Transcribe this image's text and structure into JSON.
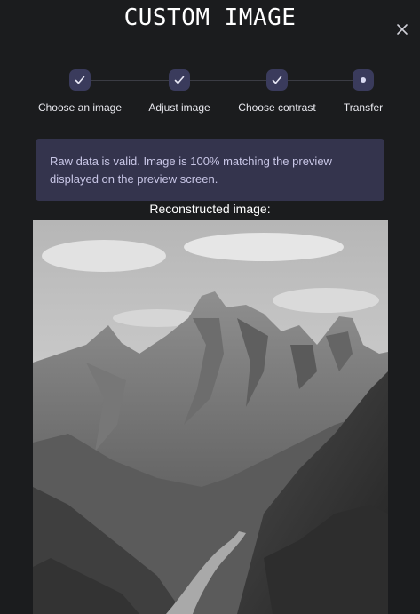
{
  "dialog": {
    "title": "CUSTOM IMAGE",
    "close_icon": "close-icon"
  },
  "steps": [
    {
      "label": "Choose an image",
      "status": "completed",
      "icon": "check-icon"
    },
    {
      "label": "Adjust image",
      "status": "completed",
      "icon": "check-icon"
    },
    {
      "label": "Choose contrast",
      "status": "completed",
      "icon": "check-icon"
    },
    {
      "label": "Transfer",
      "status": "current",
      "icon": "dot-icon"
    }
  ],
  "info": {
    "message": "Raw data is valid. Image is 100% matching the preview displayed on the preview screen."
  },
  "reconstructed": {
    "label": "Reconstructed image:",
    "image_description": "grayscale-mountain-landscape"
  },
  "colors": {
    "background": "#1b1c1e",
    "step_circle": "#3a3b5c",
    "info_background": "#34344d",
    "info_text": "#c8c6e6"
  }
}
